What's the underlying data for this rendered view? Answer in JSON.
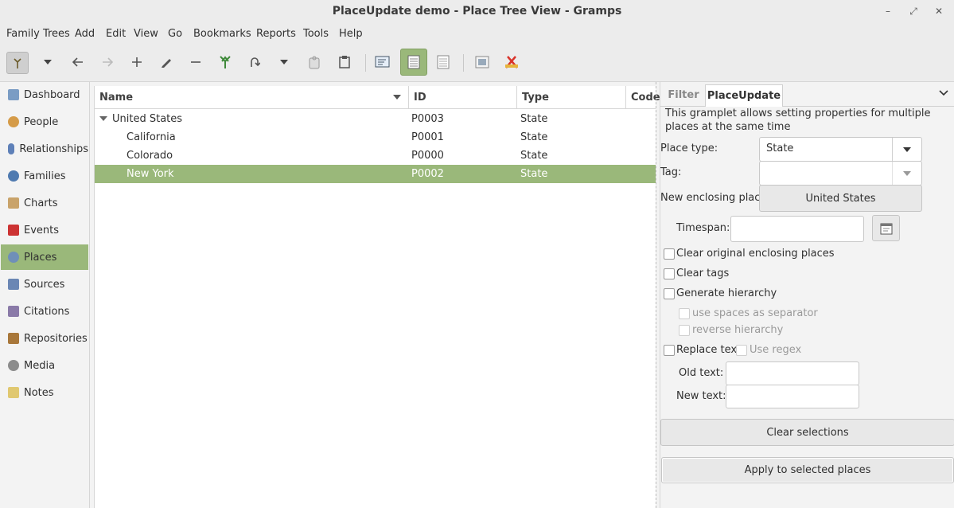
{
  "window": {
    "title": "PlaceUpdate demo - Place Tree View - Gramps"
  },
  "menu": [
    "Family Trees",
    "Add",
    "Edit",
    "View",
    "Go",
    "Bookmarks",
    "Reports",
    "Tools",
    "Help"
  ],
  "sidebar": {
    "items": [
      {
        "label": "Dashboard",
        "icon": "dashboard-icon"
      },
      {
        "label": "People",
        "icon": "person-icon"
      },
      {
        "label": "Relationships",
        "icon": "relationships-icon"
      },
      {
        "label": "Families",
        "icon": "family-icon"
      },
      {
        "label": "Charts",
        "icon": "chart-icon"
      },
      {
        "label": "Events",
        "icon": "calendar-icon"
      },
      {
        "label": "Places",
        "icon": "globe-icon"
      },
      {
        "label": "Sources",
        "icon": "source-icon"
      },
      {
        "label": "Citations",
        "icon": "citation-icon"
      },
      {
        "label": "Repositories",
        "icon": "repository-icon"
      },
      {
        "label": "Media",
        "icon": "media-icon"
      },
      {
        "label": "Notes",
        "icon": "note-icon"
      }
    ],
    "active": "Places"
  },
  "list": {
    "columns": [
      "Name",
      "ID",
      "Type",
      "Code"
    ],
    "rows": [
      {
        "name": "United States",
        "id": "P0003",
        "type": "State"
      },
      {
        "name": "California",
        "id": "P0001",
        "type": "State"
      },
      {
        "name": "Colorado",
        "id": "P0000",
        "type": "State"
      },
      {
        "name": "New York",
        "id": "P0002",
        "type": "State"
      }
    ]
  },
  "gramplet": {
    "tabs": [
      "Filter",
      "PlaceUpdate"
    ],
    "description": "This gramplet allows setting properties for multiple places at the same time",
    "place_type_label": "Place type:",
    "place_type_value": "State",
    "tag_label": "Tag:",
    "tag_value": "",
    "new_enclosing_label": "New enclosing place",
    "new_enclosing_value": "United States",
    "timespan_label": "Timespan:",
    "clear_enclosing": "Clear original enclosing places",
    "clear_tags": "Clear tags",
    "generate_hierarchy": "Generate hierarchy",
    "use_spaces": "use spaces as separator",
    "reverse_hierarchy": "reverse hierarchy",
    "replace_text": "Replace text",
    "use_regex": "Use regex",
    "old_text_label": "Old text:",
    "new_text_label": "New text:",
    "clear_selections": "Clear selections",
    "apply": "Apply to selected places"
  },
  "colors": {
    "accent": "#9ab87a"
  }
}
